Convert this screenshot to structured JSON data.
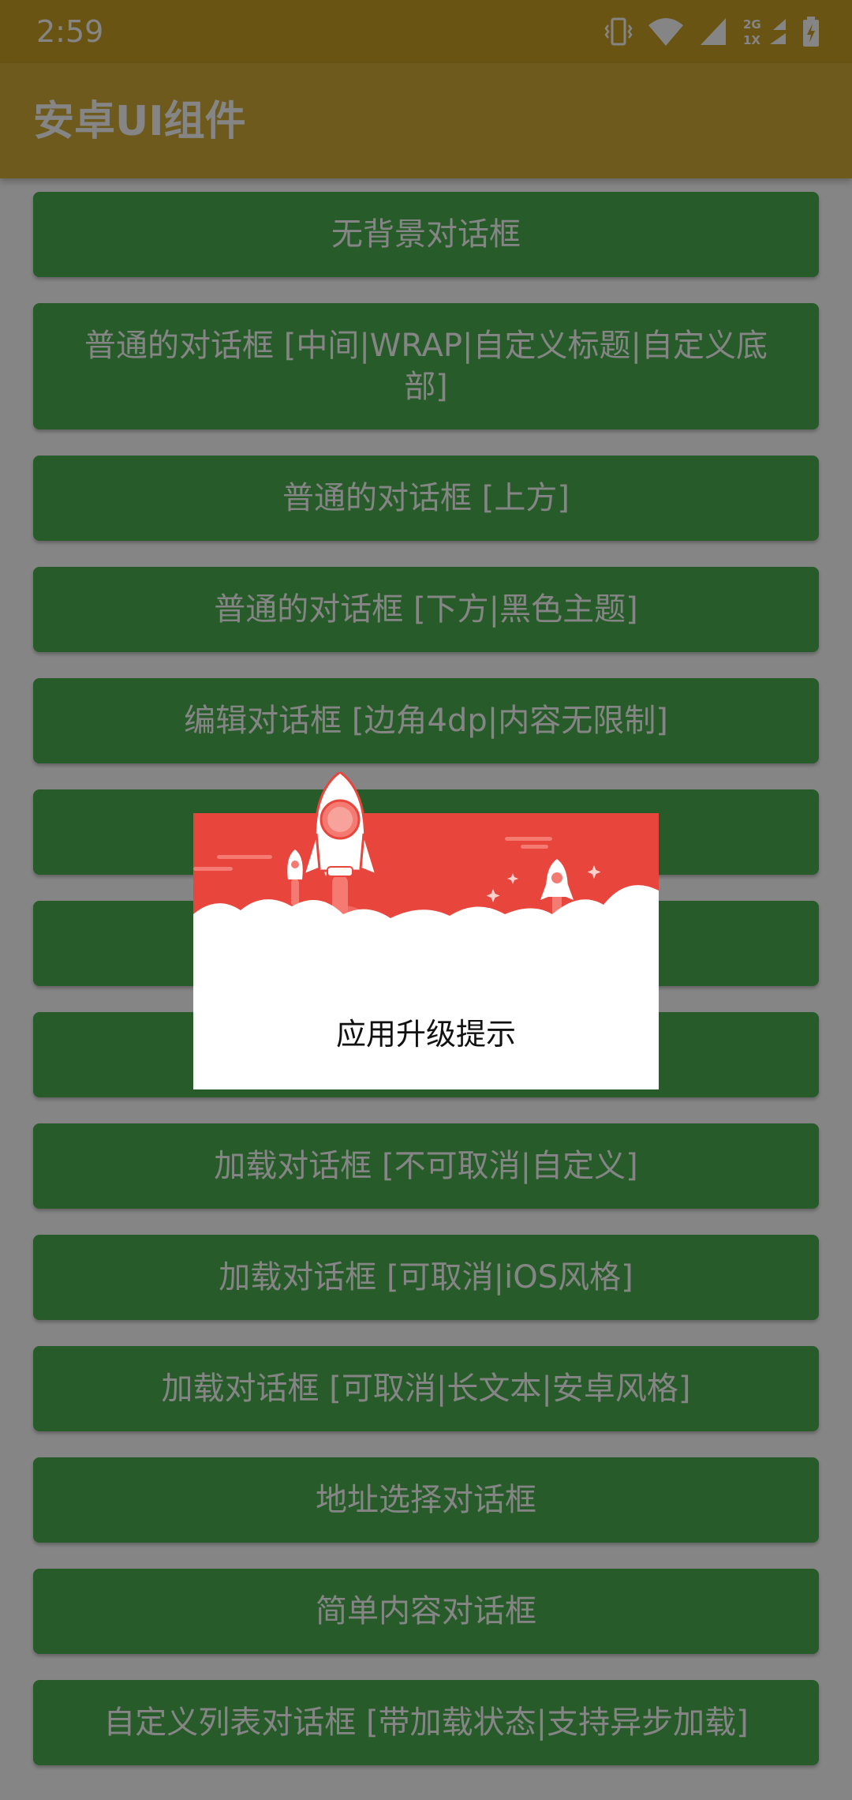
{
  "status_bar": {
    "time": "2:59",
    "icons": [
      "vibrate-icon",
      "wifi-icon",
      "signal-icon",
      "network-2g-icon",
      "battery-charging-icon"
    ],
    "network_label_top": "2G",
    "network_label_bottom": "1X"
  },
  "app_bar": {
    "title": "安卓UI组件"
  },
  "buttons": [
    {
      "label": "无背景对话框"
    },
    {
      "label": "普通的对话框 [中间|WRAP|自定义标题|自定义底部]"
    },
    {
      "label": "普通的对话框 [上方]"
    },
    {
      "label": "普通的对话框 [下方|黑色主题]"
    },
    {
      "label": "编辑对话框 [边角4dp|内容无限制]"
    },
    {
      "label": ""
    },
    {
      "label": ""
    },
    {
      "label": ""
    },
    {
      "label": "加载对话框 [不可取消|自定义]"
    },
    {
      "label": "加载对话框 [可取消|iOS风格]"
    },
    {
      "label": "加载对话框 [可取消|长文本|安卓风格]"
    },
    {
      "label": "地址选择对话框"
    },
    {
      "label": "简单内容对话框"
    },
    {
      "label": "自定义列表对话框 [带加载状态|支持异步加载]"
    }
  ],
  "dialog": {
    "title": "应用升级提示",
    "illustration": "rocket-launch-illustration"
  },
  "colors": {
    "status_bar": "#c9a227",
    "app_bar": "#d1ad37",
    "button": "#4caf50",
    "dialog_header": "#e8453c",
    "scrim": "rgba(0,0,0,0.48)"
  }
}
